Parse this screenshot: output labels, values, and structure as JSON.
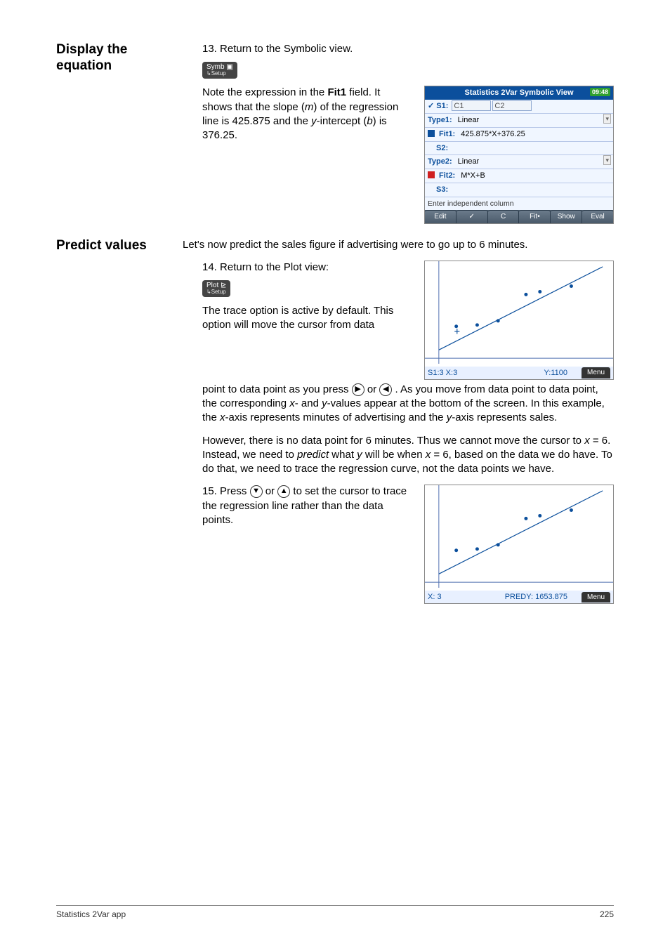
{
  "sections": {
    "display_equation": "Display the equation",
    "predict_values": "Predict values"
  },
  "steps": {
    "s13": "13. Return to the Symbolic view.",
    "s14a": "14. Return to the Plot view:",
    "s15a": "15. Press",
    "s15b": "to set the cursor to trace the regression line rather than the data points."
  },
  "keys": {
    "symb_top": "Symb ▣",
    "symb_sub": "↳Setup",
    "plot_top": "Plot ⊵",
    "plot_sub": "↳Setup",
    "right": "▶",
    "left": "◀",
    "down": "▼",
    "up": "▲",
    "or": " or "
  },
  "para_eq_a": "Note the expression in the ",
  "para_eq_b_bold": "Fit1",
  "para_eq_c": " field. It shows that the slope (",
  "para_eq_m": "m",
  "para_eq_d": ") of the regression line is 425.875 and the ",
  "para_eq_yint_label_a": "y",
  "para_eq_e": "-intercept (",
  "para_eq_b": "b",
  "para_eq_f": ") is 376.25.",
  "predict_intro": "Let's now predict the sales figure if advertising were to go up to 6 minutes.",
  "trace_p1": "The trace option is active by default. This option will move the cursor from data point to data point as you press ",
  "trace_p1b": ". As you move from data point to data point, the corresponding ",
  "trace_x": "x",
  "trace_and": "- and ",
  "trace_y": "y",
  "trace_p1c": "-values appear at the bottom of the screen. In this example, the ",
  "trace_p1d": "-axis represents minutes of advertising and the ",
  "trace_p1e": "-axis represents sales.",
  "trace_p2a": "However, there is no data point for 6 minutes. Thus we cannot move the cursor to ",
  "trace_p2b": " = 6. Instead, we need to ",
  "trace_predict": "predict",
  "trace_p2c": " what ",
  "trace_p2d": " will be when ",
  "trace_p2e": " = 6, based on the data we do have. To do that, we need to trace the regression curve, not the data points we have.",
  "calc": {
    "title": "Statistics 2Var Symbolic View",
    "battery": "09:48",
    "s1_check": "✓",
    "s1_label": "S1:",
    "s1_v1": "C1",
    "s1_v2": "C2",
    "type1_label": "Type1:",
    "type1_val": "Linear",
    "fit1_label": "Fit1:",
    "fit1_val": "425.875*X+376.25",
    "s2_label": "S2:",
    "type2_label": "Type2:",
    "type2_val": "Linear",
    "fit2_label": "Fit2:",
    "fit2_val": "M*X+B",
    "s3_label": "S3:",
    "hint": "Enter independent column",
    "tb": [
      "Edit",
      "✓",
      "C",
      "Fit•",
      "Show",
      "Eval"
    ]
  },
  "plot1": {
    "status_left": "S1:3 X:3",
    "status_mid": "Y:1100",
    "menu": "Menu"
  },
  "plot2": {
    "status_left": "X: 3",
    "status_mid": "PREDY: 1653.875",
    "menu": "Menu"
  },
  "footer": {
    "left": "Statistics 2Var app",
    "right": "225"
  }
}
